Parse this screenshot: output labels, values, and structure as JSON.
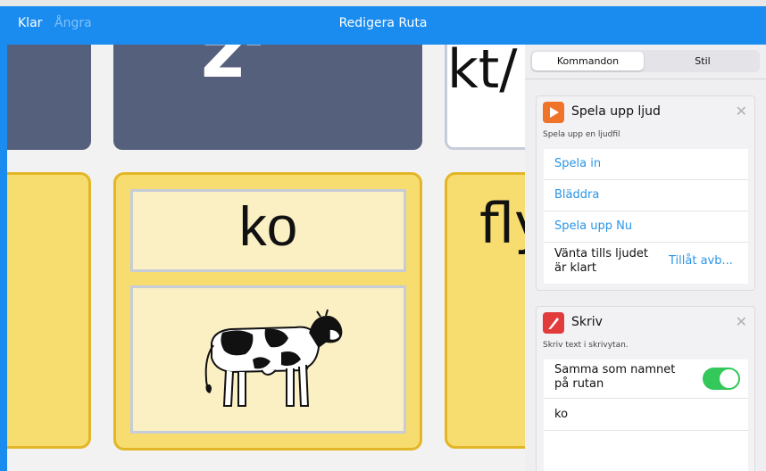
{
  "topbar": {
    "done": "Klar",
    "undo": "Ångra",
    "title": "Redigera Ruta"
  },
  "grid": {
    "tile_ko_word": "ko",
    "tile_ko_image": "cow",
    "partial_word_1": "kt/",
    "partial_word_2": "fly"
  },
  "panel": {
    "tabs": {
      "commands": "Kommandon",
      "style": "Stil"
    },
    "play_sound": {
      "title": "Spela upp ljud",
      "subtitle": "Spela upp en ljudfil",
      "icon": "play-icon",
      "rows": {
        "record": "Spela in",
        "browse": "Bläddra",
        "play_now": "Spela upp Nu",
        "wait_label_1": "Vänta tills ljudet",
        "wait_label_2": "är klart",
        "wait_value": "Tillåt avb..."
      }
    },
    "write": {
      "title": "Skriv",
      "subtitle": "Skriv text i skrivytan.",
      "icon": "pen-icon",
      "toggle_label_1": "Samma som namnet",
      "toggle_label_2": "på rutan",
      "toggle_on": true,
      "text": "ko"
    }
  },
  "colors": {
    "accent": "#1a8cf0",
    "tile_yellow": "#f7dc6f",
    "tile_blue": "#55607c",
    "toggle": "#34c759",
    "play": "#f0732a",
    "pen": "#e23b3b"
  }
}
